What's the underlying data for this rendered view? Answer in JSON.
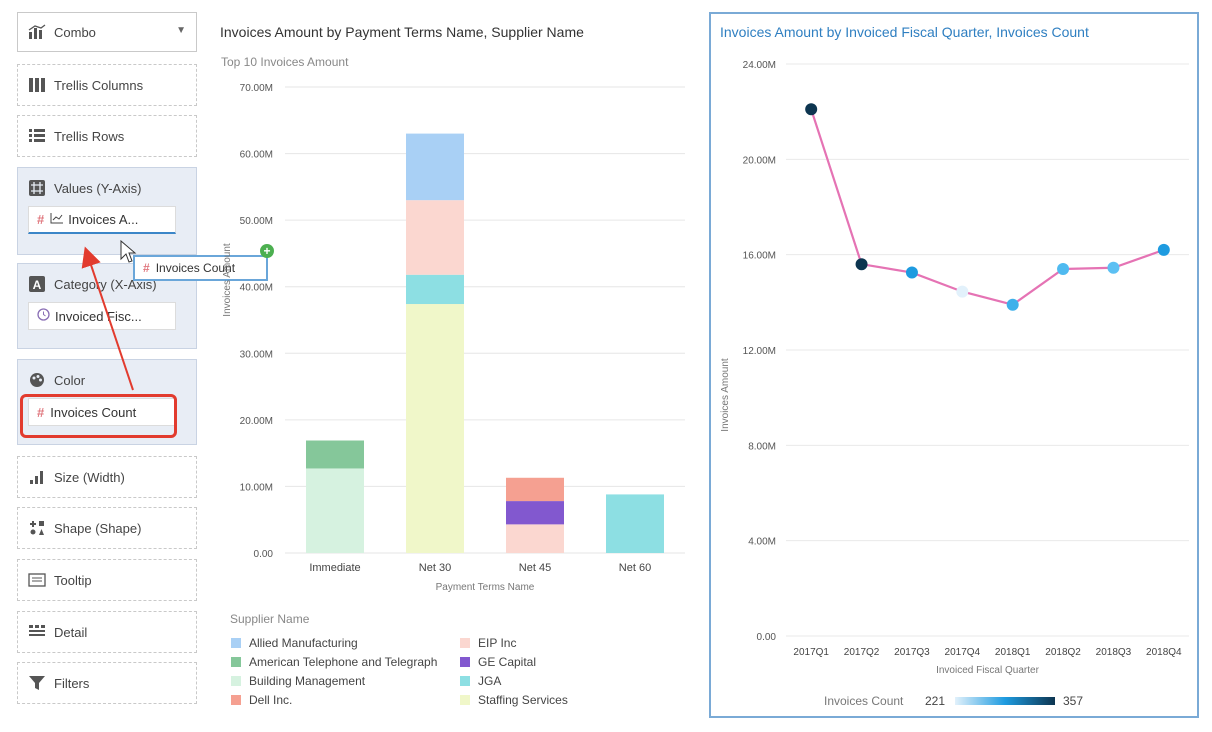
{
  "left_panel": {
    "combo_label": "Combo",
    "trellis_columns": "Trellis Columns",
    "trellis_rows": "Trellis Rows",
    "values_header": "Values (Y-Axis)",
    "values_chip": "Invoices A...",
    "category_header": "Category (X-Axis)",
    "category_chip": "Invoiced Fisc...",
    "color_header": "Color",
    "color_chip": "Invoices Count",
    "size": "Size (Width)",
    "shape": "Shape (Shape)",
    "tooltip": "Tooltip",
    "detail": "Detail",
    "filters": "Filters",
    "drag_label": "Invoices Count"
  },
  "colors": {
    "highlight": "#e23b2e",
    "drag_border": "#6aa6d9",
    "line": "#e573b4",
    "right_border": "#7aaad6"
  },
  "chart_data": [
    {
      "type": "bar",
      "stacked": true,
      "title": "Invoices Amount by Payment Terms Name, Supplier Name",
      "subtitle": "Top 10 Invoices Amount",
      "xlabel": "Payment Terms Name",
      "ylabel": "Invoices Amount",
      "ylim": [
        0,
        70
      ],
      "yticks": [
        "0.00",
        "10.00M",
        "20.00M",
        "30.00M",
        "40.00M",
        "50.00M",
        "60.00M",
        "70.00M"
      ],
      "categories": [
        "Immediate",
        "Net 30",
        "Net 45",
        "Net 60"
      ],
      "legend_title": "Supplier Name",
      "series": [
        {
          "name": "Allied Manufacturing",
          "color": "#a9d0f5",
          "values": [
            0,
            10,
            0,
            0
          ]
        },
        {
          "name": "American Telephone and Telegraph",
          "color": "#85c79a",
          "values": [
            4.2,
            0,
            0,
            0
          ]
        },
        {
          "name": "Building Management",
          "color": "#d6f2e0",
          "values": [
            12.7,
            0,
            0,
            0
          ]
        },
        {
          "name": "Dell Inc.",
          "color": "#f5a091",
          "values": [
            0,
            0,
            3.5,
            0
          ]
        },
        {
          "name": "EIP Inc",
          "color": "#fbd7d0",
          "values": [
            0,
            11.2,
            4.3,
            0
          ]
        },
        {
          "name": "GE Capital",
          "color": "#8258cf",
          "values": [
            0,
            0,
            3.5,
            0
          ]
        },
        {
          "name": "JGA",
          "color": "#8ddfe3",
          "values": [
            0,
            4.4,
            0,
            8.8
          ]
        },
        {
          "name": "Staffing Services",
          "color": "#f0f7c9",
          "values": [
            0,
            37.4,
            0,
            0
          ]
        }
      ],
      "stack_order": [
        "Building Management",
        "American Telephone and Telegraph",
        "Staffing Services",
        "JGA",
        "EIP Inc",
        "Allied Manufacturing",
        "GE Capital",
        "Dell Inc."
      ]
    },
    {
      "type": "line",
      "title": "Invoices Amount by Invoiced Fiscal Quarter, Invoices Count",
      "xlabel": "Invoiced Fiscal Quarter",
      "ylabel": "Invoices Amount",
      "ylim": [
        0,
        24
      ],
      "yticks": [
        "0.00",
        "4.00M",
        "8.00M",
        "12.00M",
        "16.00M",
        "20.00M",
        "24.00M"
      ],
      "x": [
        "2017Q1",
        "2017Q2",
        "2017Q3",
        "2017Q4",
        "2018Q1",
        "2018Q2",
        "2018Q3",
        "2018Q4"
      ],
      "values": [
        22.1,
        15.6,
        15.25,
        14.45,
        13.9,
        15.4,
        15.45,
        16.2
      ],
      "point_colors": [
        "#0d3550",
        "#0d3550",
        "#1e9be0",
        "#e2f1fb",
        "#3eb0ea",
        "#4fbaf0",
        "#5cc0f3",
        "#1e9be0"
      ],
      "line_color": "#e573b4",
      "color_legend": {
        "label": "Invoices Count",
        "min": "221",
        "max": "357"
      }
    }
  ]
}
